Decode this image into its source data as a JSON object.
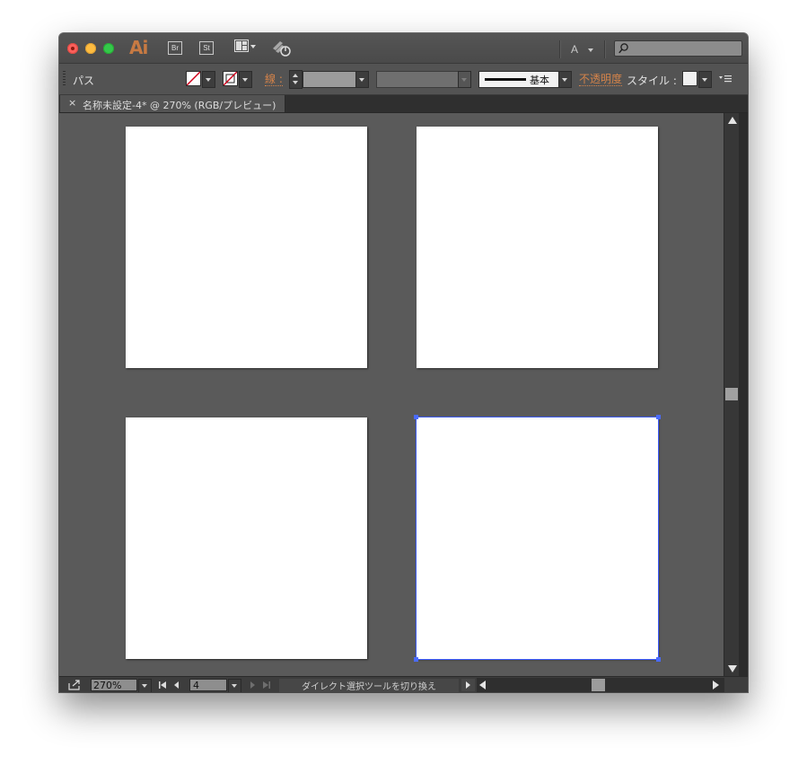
{
  "app": {
    "logo": "Ai",
    "bridge_label": "Br",
    "stock_label": "St",
    "workspace_switcher": "A",
    "search": {
      "placeholder": ""
    }
  },
  "controlbar": {
    "selection_type": "パス",
    "stroke_label": "線 :",
    "stroke_profile_label": "基本",
    "opacity_label": "不透明度",
    "style_label": "スタイル :"
  },
  "document": {
    "tab_close": "×",
    "tab_title": "名称未設定-4* @ 270% (RGB/プレビュー)"
  },
  "statusbar": {
    "zoom": "270%",
    "artboard_number": "4",
    "status_text": "ダイレクト選択ツールを切り換え"
  },
  "colors": {
    "accent_orange": "#d4834a",
    "selection_blue": "#3b59ff",
    "canvas_gray": "#5a5a5a",
    "artboard_white": "#ffffff"
  },
  "artboards": [
    {
      "name": "artboard-1",
      "selected": false
    },
    {
      "name": "artboard-2",
      "selected": false
    },
    {
      "name": "artboard-3",
      "selected": false
    },
    {
      "name": "artboard-4",
      "selected": true
    }
  ]
}
